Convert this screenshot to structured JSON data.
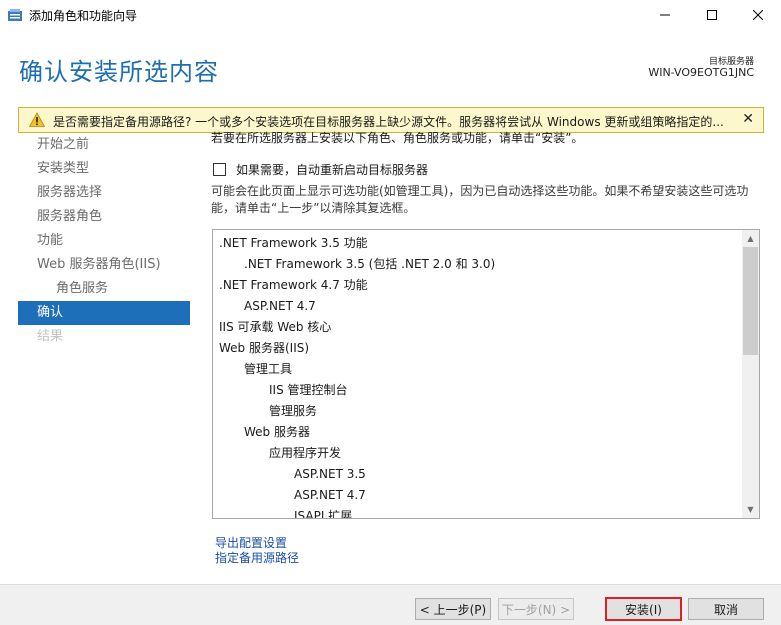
{
  "window": {
    "title": "添加角色和功能向导"
  },
  "header": {
    "page_title": "确认安装所选内容",
    "target_label": "目标服务器",
    "target_name": "WIN-VO9EOTG1JNC"
  },
  "warning": {
    "text": "是否需要指定备用源路径? 一个或多个安装选项在目标服务器上缺少源文件。服务器将尝试从 Windows 更新或组策略指定的..."
  },
  "nav": {
    "items": [
      {
        "label": "开始之前",
        "state": "normal"
      },
      {
        "label": "安装类型",
        "state": "normal"
      },
      {
        "label": "服务器选择",
        "state": "normal"
      },
      {
        "label": "服务器角色",
        "state": "normal"
      },
      {
        "label": "功能",
        "state": "normal"
      },
      {
        "label": "Web 服务器角色(IIS)",
        "state": "normal"
      },
      {
        "label": "角色服务",
        "state": "sub"
      },
      {
        "label": "确认",
        "state": "active"
      },
      {
        "label": "结果",
        "state": "disabled"
      }
    ]
  },
  "content": {
    "intro": "若要在所选服务器上安装以下角色、角色服务或功能，请单击“安装”。",
    "restart_label": "如果需要，自动重新启动目标服务器",
    "description": "可能会在此页面上显示可选功能(如管理工具)，因为已自动选择这些功能。如果不希望安装这些可选功能，请单击“上一步”以清除其复选框。"
  },
  "selection_list": [
    {
      "text": ".NET Framework 3.5 功能",
      "level": 0
    },
    {
      "text": ".NET Framework 3.5 (包括 .NET 2.0 和 3.0)",
      "level": 1
    },
    {
      "text": ".NET Framework 4.7 功能",
      "level": 0
    },
    {
      "text": "ASP.NET 4.7",
      "level": 1
    },
    {
      "text": "IIS 可承载 Web 核心",
      "level": 0
    },
    {
      "text": "Web 服务器(IIS)",
      "level": 0
    },
    {
      "text": "管理工具",
      "level": 1
    },
    {
      "text": "IIS 管理控制台",
      "level": 2
    },
    {
      "text": "管理服务",
      "level": 2
    },
    {
      "text": "Web 服务器",
      "level": 1
    },
    {
      "text": "应用程序开发",
      "level": 2
    },
    {
      "text": "ASP.NET 3.5",
      "level": 3
    },
    {
      "text": "ASP.NET 4.7",
      "level": 3
    },
    {
      "text": "ISAPI 扩展",
      "level": 3
    }
  ],
  "links": {
    "export": "导出配置设置",
    "alt_source": "指定备用源路径"
  },
  "buttons": {
    "previous": "< 上一步(P)",
    "next": "下一步(N) >",
    "install": "安装(I)",
    "cancel": "取消"
  }
}
